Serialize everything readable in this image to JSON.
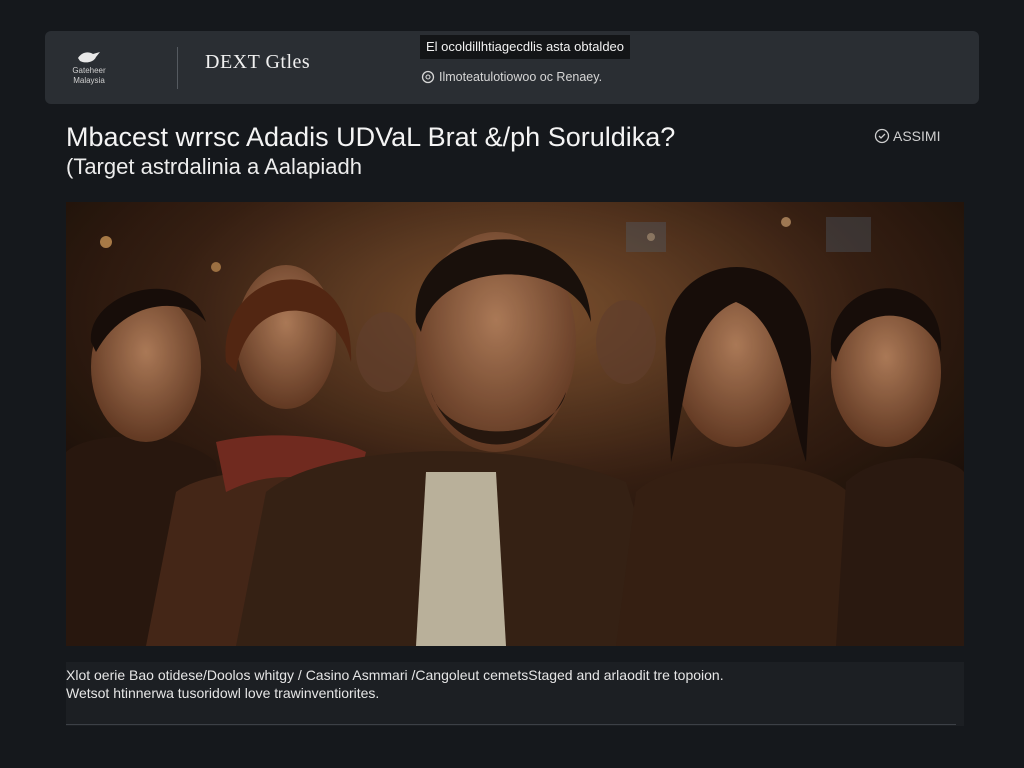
{
  "header": {
    "logo_text_line1": "Gateheer",
    "logo_text_line2": "Malaysia",
    "brand": "DEXT Gtles",
    "notice": "El ocoldillhtiagecdlis asta obtaldeo",
    "subline": "Ilmoteatulotiowoo oc Renaey."
  },
  "article": {
    "headline": "Mbacest wrrsc Adadis UDVaL Brat &/ph Soruldika?",
    "subhead": "(Target astrdalinia a Aalapiadh",
    "tag": "ASSIMI",
    "hero_image": "cinematic-group-portrait"
  },
  "caption": {
    "line1": "Xlot oerie Bao otidese/Doolos whitgy / Casino Asmmari /Cangoleut cemetsStaged and arlaodit tre topoion.",
    "line2": "Wetsot htinnerwa tusoridowl love trawinventiorites."
  },
  "colors": {
    "background": "#15181c",
    "topbar": "#2a2e33",
    "hero_warm": "#6b3a1c"
  }
}
